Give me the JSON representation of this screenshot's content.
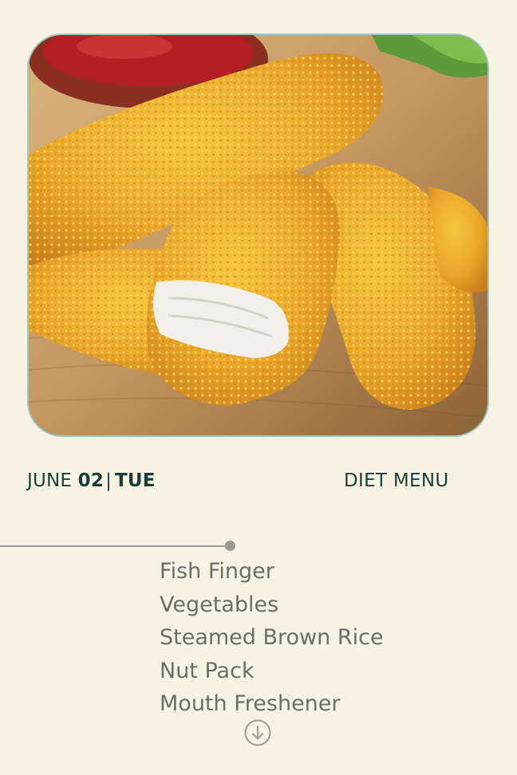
{
  "hero_image": {
    "description_icon": "fish-fingers-photo"
  },
  "date": {
    "month": "JUNE",
    "day": "02",
    "separator": "|",
    "weekday": "TUE"
  },
  "section_title": "DIET MENU",
  "menu": {
    "items": [
      "Fish Finger",
      "Vegetables",
      "Steamed Brown Rice",
      "Nut Pack",
      "Mouth Freshener"
    ]
  },
  "controls": {
    "scroll_icon": "arrow-down-circle-icon"
  },
  "colors": {
    "background": "#f6f3e2",
    "heading_text": "#1c3d3a",
    "menu_text": "#6d6d68",
    "timeline": "#9b9b95",
    "image_border": "#9fc6c4"
  }
}
